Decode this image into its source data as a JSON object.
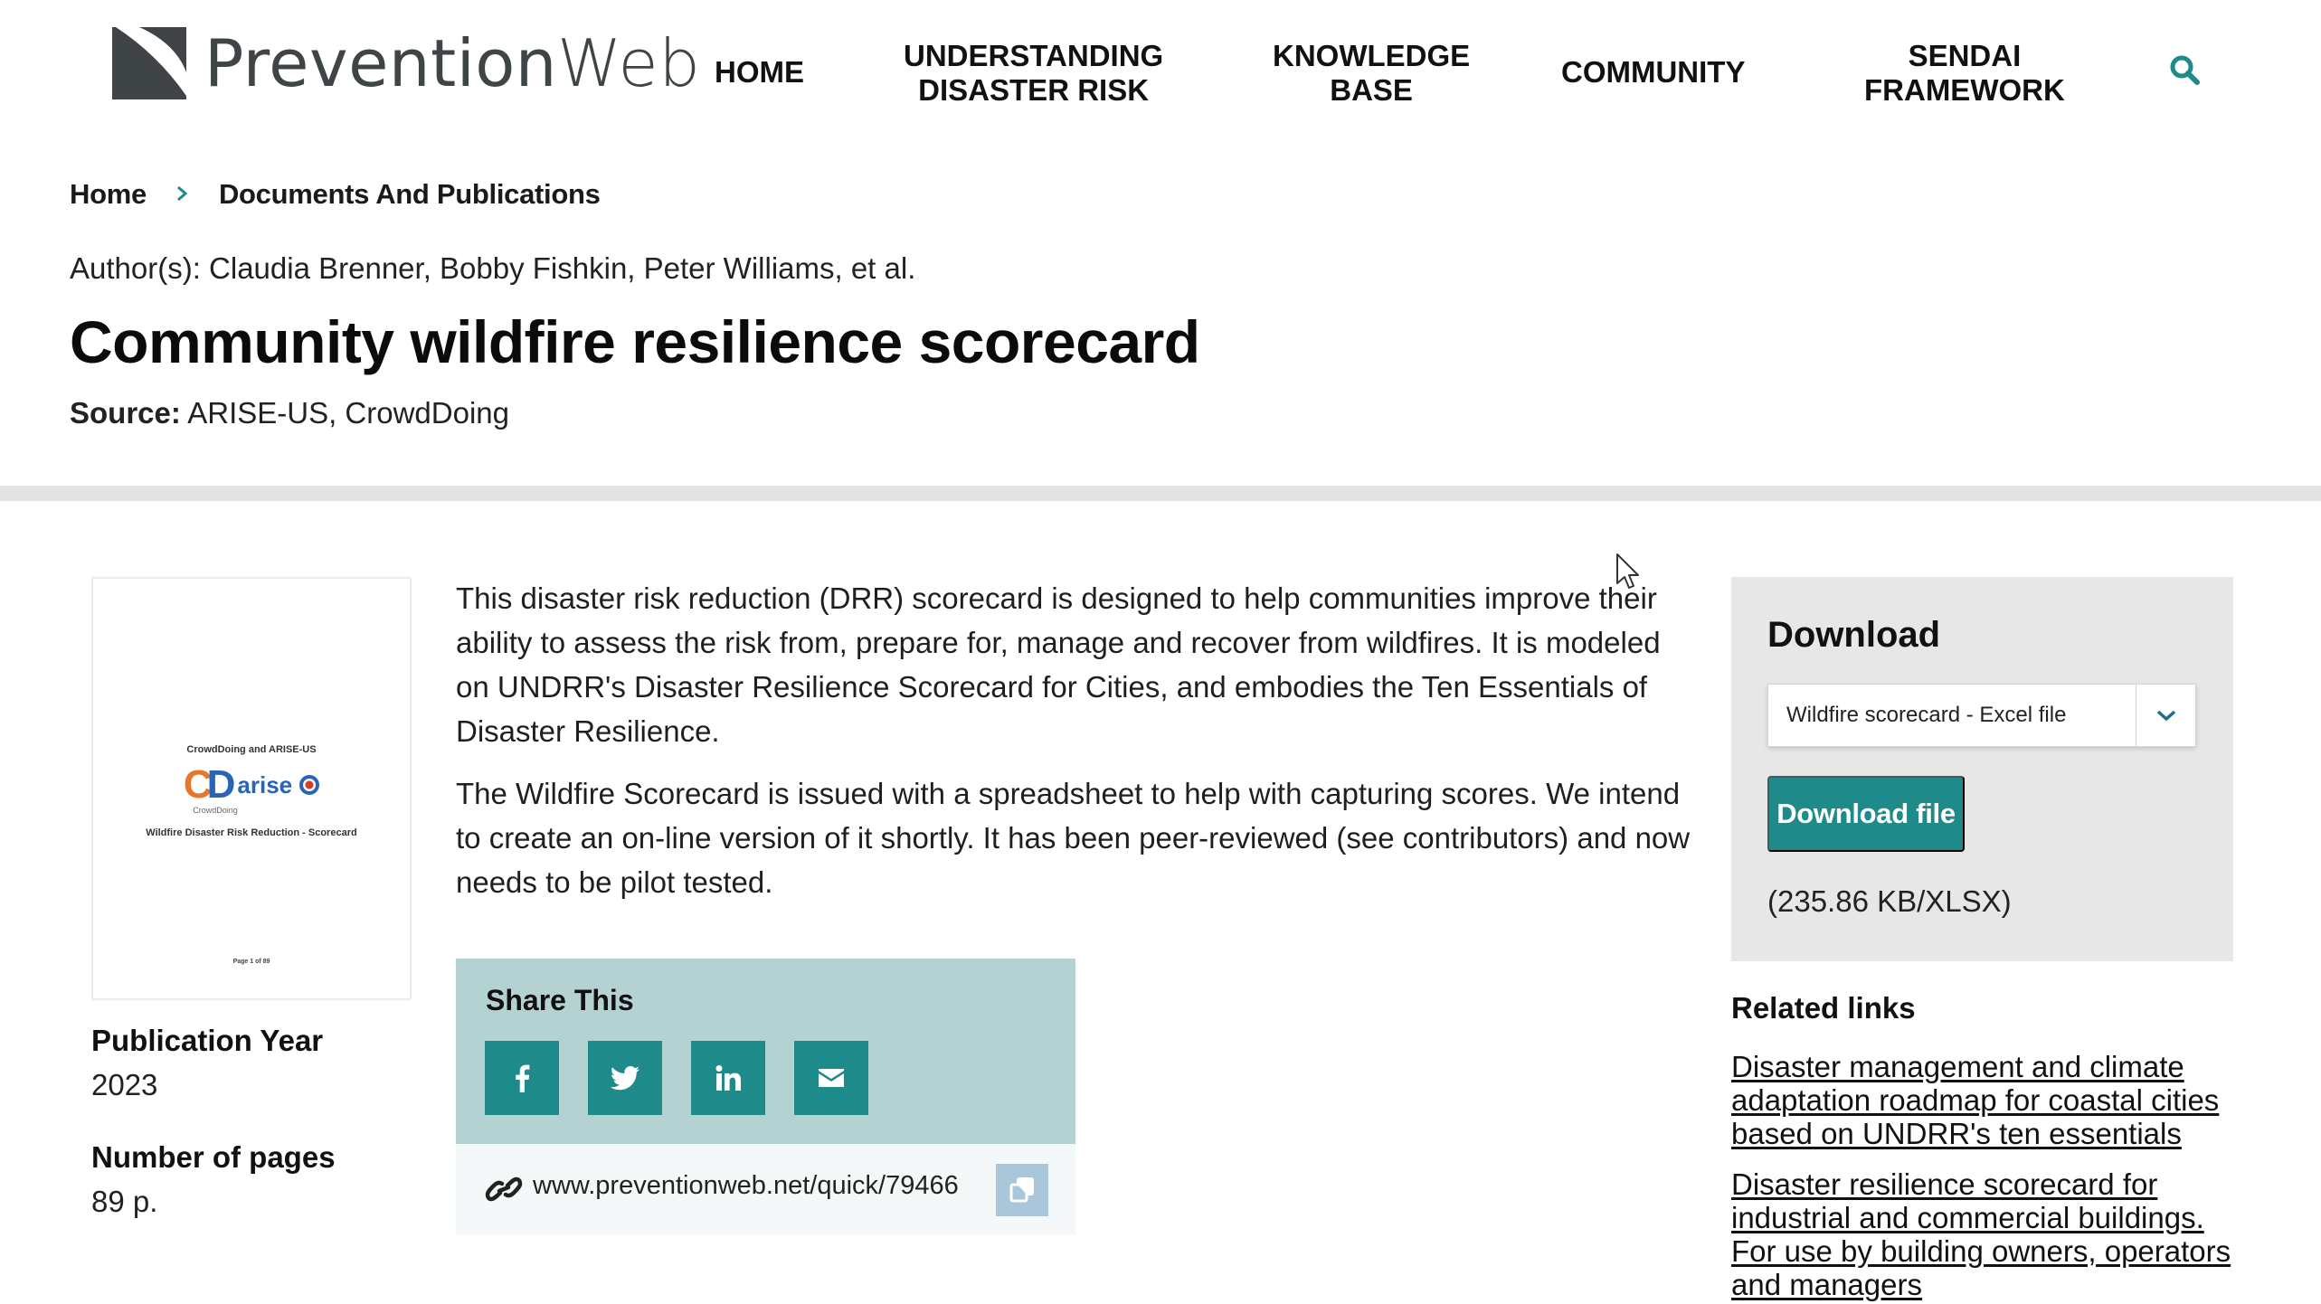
{
  "site": {
    "logo_prefix": "Prevention",
    "logo_suffix": "Web"
  },
  "nav": {
    "items": [
      {
        "line1": "HOME",
        "line2": ""
      },
      {
        "line1": "UNDERSTANDING",
        "line2": "DISASTER RISK"
      },
      {
        "line1": "KNOWLEDGE",
        "line2": "BASE"
      },
      {
        "line1": "COMMUNITY",
        "line2": ""
      },
      {
        "line1": "SENDAI",
        "line2": "FRAMEWORK"
      }
    ],
    "search_icon": "search-icon"
  },
  "breadcrumb": {
    "home": "Home",
    "separator": ">",
    "current": "Documents And Publications"
  },
  "document": {
    "authors": "Author(s): Claudia Brenner, Bobby Fishkin, Peter Williams, et al.",
    "title": "Community wildfire resilience scorecard",
    "source_label": "Source:",
    "source_value": " ARISE-US, CrowdDoing",
    "cover": {
      "line1": "CrowdDoing and ARISE-US",
      "cd_c": "C",
      "cd_d": "D",
      "arise": "arise",
      "crowddoing": "CrowdDoing",
      "line2": "Wildfire Disaster Risk Reduction - Scorecard",
      "page": "Page 1 of 89"
    },
    "publication_year_label": "Publication Year",
    "publication_year": "2023",
    "pages_label": "Number of pages",
    "pages": "89 p.",
    "paragraph1": "This disaster risk reduction (DRR) scorecard is designed to help communities improve their ability to assess the risk from, prepare for, manage and recover from wildfires. It is modeled on UNDRR's Disaster Resilience Scorecard for Cities, and embodies the Ten Essentials of Disaster Resilience.",
    "paragraph2": "The Wildfire Scorecard is issued with a spreadsheet to help with capturing scores.  We intend to create an on-line version of it shortly.  It has been peer-reviewed (see contributors) and now needs to be pilot tested."
  },
  "share": {
    "title": "Share This",
    "buttons": [
      "facebook-icon",
      "twitter-icon",
      "linkedin-icon",
      "email-icon"
    ],
    "quick_link": "www.preventionweb.net/quick/79466"
  },
  "download": {
    "title": "Download",
    "selected_file": "Wildfire scorecard - Excel file",
    "button_label": "Download file",
    "file_info": "(235.86 KB/XLSX)"
  },
  "related": {
    "title": "Related links",
    "links": [
      {
        "lines": [
          "Disaster management and climate",
          "adaptation roadmap for coastal cities",
          "based on UNDRR's ten essentials"
        ]
      },
      {
        "lines": [
          "Disaster resilience scorecard for",
          "industrial and commercial buildings.",
          "For use by building owners, operators",
          "and managers"
        ]
      }
    ]
  },
  "colors": {
    "accent_teal": "#1f8a8a",
    "share_bg": "#b5d2d3",
    "download_bg": "#e7e7e7",
    "divider": "#e3e3e3",
    "copy_btn": "#a9c6db"
  }
}
